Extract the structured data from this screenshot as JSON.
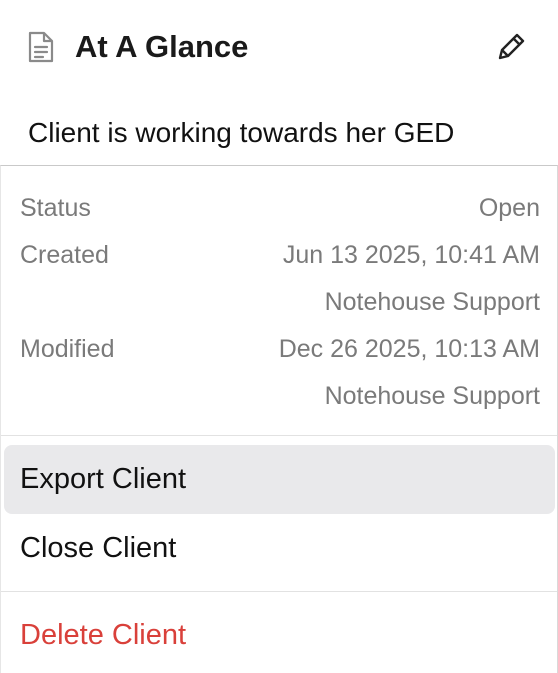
{
  "glance": {
    "title": "At A Glance",
    "note": "Client is working towards her GED",
    "icons": {
      "title": "document-icon",
      "edit": "pencil-icon"
    }
  },
  "meta": {
    "status_label": "Status",
    "status_value": "Open",
    "created_label": "Created",
    "created_value": "Jun 13 2025, 10:41 AM",
    "created_by": "Notehouse Support",
    "modified_label": "Modified",
    "modified_value": "Dec 26 2025, 10:13 AM",
    "modified_by": "Notehouse Support"
  },
  "menu": {
    "export_label": "Export Client",
    "close_label": "Close Client",
    "delete_label": "Delete Client"
  },
  "colors": {
    "danger": "#d9403a",
    "hover_bg": "#e9e9eb",
    "muted_text": "#7a7a7a"
  }
}
